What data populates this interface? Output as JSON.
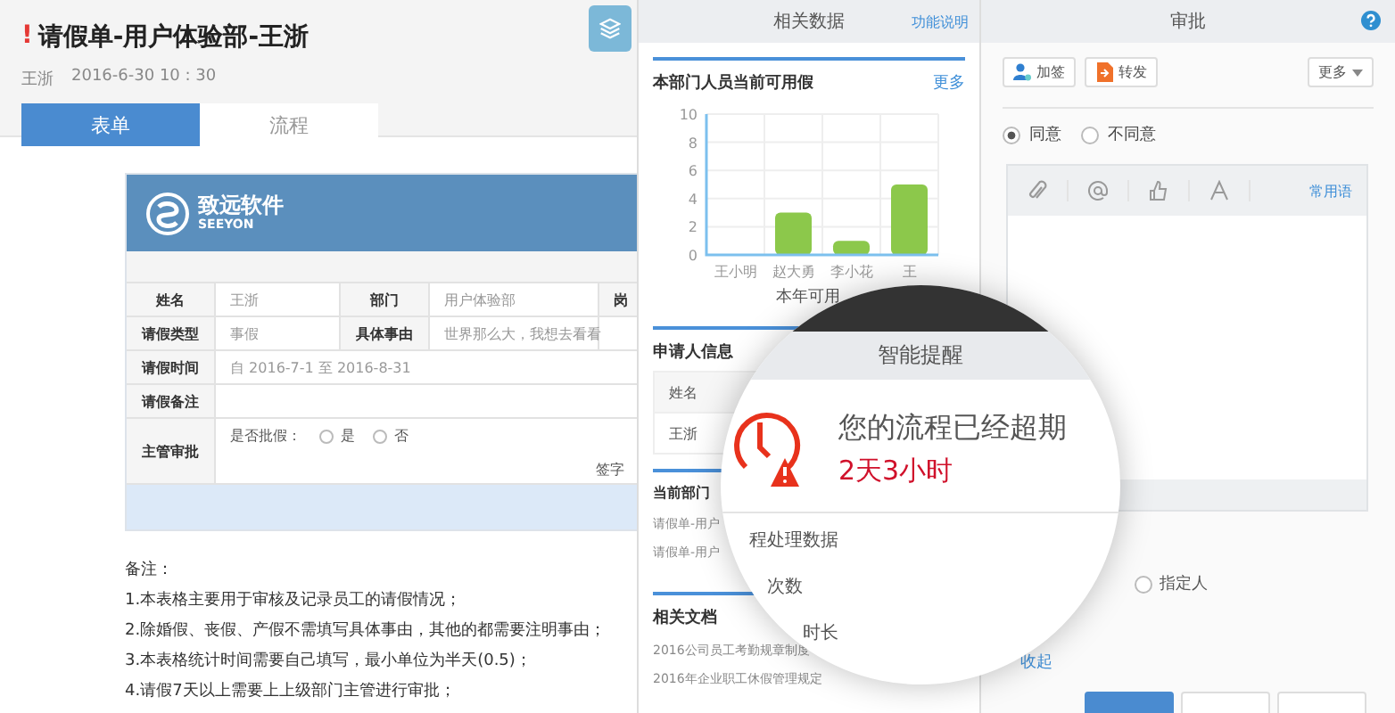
{
  "form_panel": {
    "urgent_mark": "!",
    "title": "请假单-用户体验部-王浙",
    "author": "王浙",
    "time": "2016-6-30 10 : 30",
    "tabs": [
      {
        "label": "表单",
        "selected": true
      },
      {
        "label": "流程",
        "selected": false
      }
    ],
    "form": {
      "logo_cn": "致远软件",
      "logo_en": "SEEYON",
      "rows": [
        {
          "kind": "grid",
          "cells": [
            {
              "text": "姓名",
              "header": true
            },
            {
              "text": "王浙",
              "header": false
            },
            {
              "text": "部门",
              "header": true
            },
            {
              "text": "用户体验部",
              "header": false
            },
            {
              "text": "岗",
              "header": true
            }
          ]
        },
        {
          "kind": "grid",
          "cells": [
            {
              "text": "请假类型",
              "header": true
            },
            {
              "text": "事假",
              "header": false
            },
            {
              "text": "具体事由",
              "header": true
            },
            {
              "text": "世界那么大，我想去看看",
              "header": false
            }
          ]
        },
        {
          "kind": "wide",
          "label": "请假时间",
          "value": "自 2016-7-1 至 2016-8-31"
        },
        {
          "kind": "wide",
          "label": "请假备注"
        },
        {
          "kind": "approval",
          "label": "主管审批",
          "question": "是否批假：",
          "options": [
            {
              "label": "是",
              "checked": false
            },
            {
              "label": "否",
              "checked": false
            }
          ],
          "sign": "签字"
        }
      ]
    },
    "notes": {
      "title": "备注：",
      "lines": [
        "1.本表格主要用于审核及记录员工的请假情况；",
        "2.除婚假、丧假、产假不需填写具体事由，其他的都需要注明事由；",
        "3.本表格统计时间需要自己填写，最小单位为半天(0.5)；",
        "4.请假7天以上需要上上级部门主管进行审批；"
      ]
    }
  },
  "data_panel": {
    "title": "相关数据",
    "help_link": "功能说明",
    "leave_section": {
      "title": "本部门人员当前可用假",
      "more_link": "更多",
      "chart_data": {
        "type": "bar",
        "grid": true,
        "xlabel": "本年可用",
        "categories": [
          "王小明",
          "赵大勇",
          "李小花",
          "王"
        ],
        "values": [
          0,
          3,
          1,
          5
        ],
        "ylim": [
          0,
          10
        ],
        "yticks": [
          0,
          2,
          4,
          6,
          8,
          10
        ]
      }
    },
    "applicant": {
      "title": "申请人信息",
      "columns": [
        "姓名"
      ],
      "rows": [
        [
          "王浙"
        ]
      ]
    },
    "department": {
      "title": "当前部门",
      "items": [
        "请假单-用户",
        "请假单-用户"
      ]
    },
    "documents": {
      "title": "相关文档",
      "items": [
        "2016公司员工考勤规章制度",
        "2016年企业职工休假管理规定"
      ]
    }
  },
  "approval_panel": {
    "title": "审批",
    "actions": [
      {
        "label": "加签",
        "kind": "add"
      },
      {
        "label": "转发",
        "kind": "forward"
      }
    ],
    "more": "更多",
    "opinions": [
      {
        "label": "同意",
        "selected": true
      },
      {
        "label": "不同意",
        "selected": false
      }
    ],
    "phrases_link": "常用语",
    "assign": {
      "label": "指定人",
      "selected": false
    },
    "collapse_link": "收起"
  },
  "reminder": {
    "title": "智能提醒",
    "message": "您的流程已经超期",
    "overdue": "2天3小时",
    "lines": [
      "程处理数据",
      "次数",
      "时长"
    ]
  }
}
